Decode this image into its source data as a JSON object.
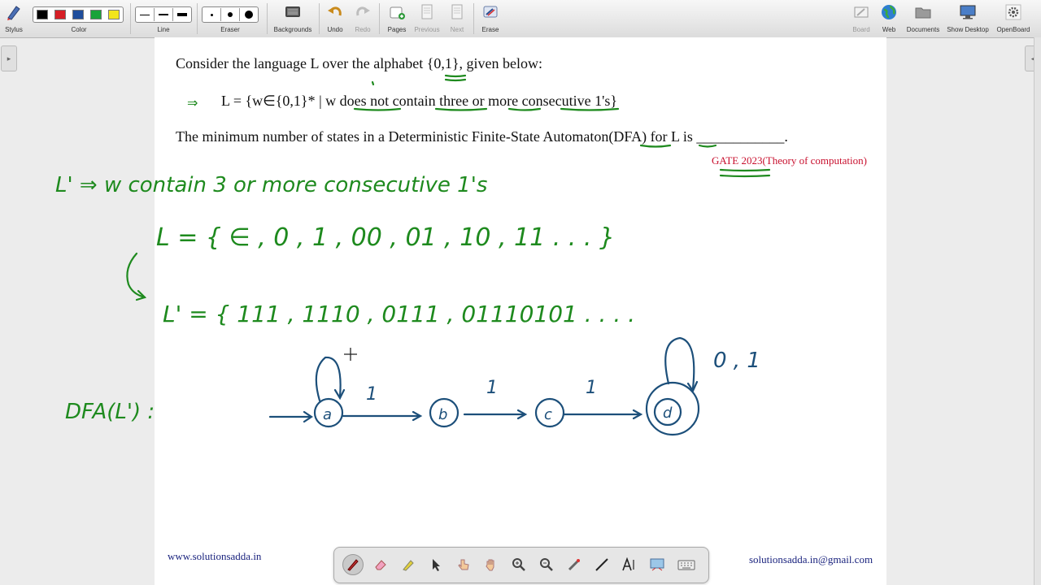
{
  "toolbar": {
    "stylus": "Stylus",
    "color": "Color",
    "line": "Line",
    "eraser": "Eraser",
    "backgrounds": "Backgrounds",
    "undo": "Undo",
    "redo": "Redo",
    "pages": "Pages",
    "previous": "Previous",
    "next": "Next",
    "erase": "Erase",
    "board": "Board",
    "web": "Web",
    "documents": "Documents",
    "show_desktop": "Show Desktop",
    "openboard": "OpenBoard",
    "colors": [
      "#000000",
      "#d61f26",
      "#1f4e9c",
      "#1aa33a",
      "#f2e51b"
    ]
  },
  "question": {
    "line1": "Consider the language L over the alphabet {0,1}, given below:",
    "line2": "L = {w∈{0,1}* | w does not contain three or more consecutive 1's}",
    "line3": "The minimum number of states in a Deterministic Finite-State Automaton(DFA) for L is ____________.",
    "source": "GATE 2023(Theory of computation)"
  },
  "handwriting": {
    "l_prime_def": "L' ⇒ w contain 3 or more consecutive 1's",
    "l_set": "L = { ∈ , 0 , 1 , 00 , 01 , 10 , 11 . . . }",
    "l_prime_set": "L' = { 111 , 1110 , 0111 , 01110101 . . . .",
    "dfa_label": "DFA(L') :",
    "states": [
      "a",
      "b",
      "c",
      "d"
    ],
    "transition_labels": [
      "1",
      "1",
      "1"
    ],
    "final_loop_label": "0 , 1",
    "arrow_mark": "⇒"
  },
  "footer": {
    "left": "www.solutionsadda.in",
    "right": "solutionsadda.in@gmail.com"
  },
  "accent": {
    "ink_green": "#1e8a1e",
    "ink_blue": "#1c4f7a",
    "gate_red": "#c8102e"
  }
}
